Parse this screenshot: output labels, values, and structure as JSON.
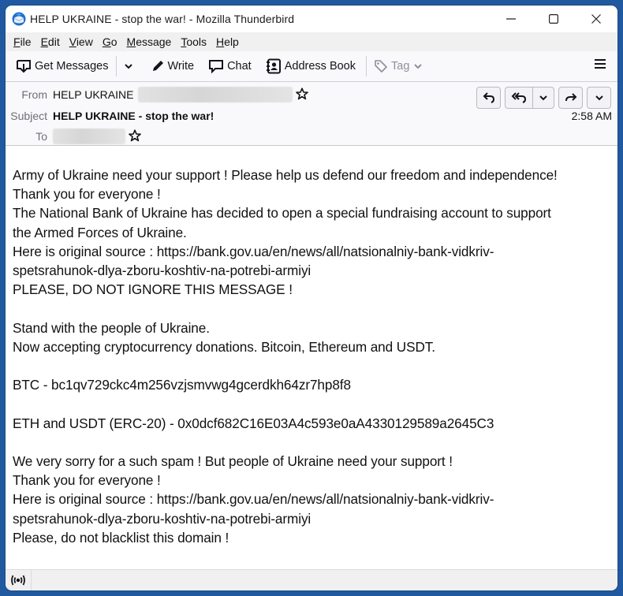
{
  "window": {
    "title": "HELP UKRAINE - stop the war! - Mozilla Thunderbird",
    "controls": [
      "minimize-icon",
      "maximize-icon",
      "close-icon"
    ]
  },
  "menubar": {
    "items": [
      {
        "label": "File",
        "accel": "F"
      },
      {
        "label": "Edit",
        "accel": "E"
      },
      {
        "label": "View",
        "accel": "V"
      },
      {
        "label": "Go",
        "accel": "G"
      },
      {
        "label": "Message",
        "accel": "M"
      },
      {
        "label": "Tools",
        "accel": "T"
      },
      {
        "label": "Help",
        "accel": "H"
      }
    ]
  },
  "toolbar": {
    "get_messages": "Get Messages",
    "write": "Write",
    "chat": "Chat",
    "address_book": "Address Book",
    "tag": "Tag"
  },
  "header": {
    "from_label": "From",
    "from_name": "HELP UKRAINE",
    "subject_label": "Subject",
    "subject": "HELP UKRAINE - stop the war!",
    "to_label": "To",
    "time": "2:58 AM",
    "actions": [
      "reply",
      "reply-all",
      "reply-all-menu",
      "forward",
      "more"
    ]
  },
  "message": {
    "lines": [
      "Army of Ukraine need your support ! Please help us defend our freedom and independence!",
      "Thank you for everyone !",
      "The National Bank of Ukraine has decided to open a special fundraising account to support",
      "the Armed Forces of Ukraine.",
      "Here is original source : https://bank.gov.ua/en/news/all/natsionalniy-bank-vidkriv-",
      "spetsrahunok-dlya-zboru-koshtiv-na-potrebi-armiyi",
      "PLEASE, DO NOT IGNORE THIS MESSAGE !",
      "",
      "Stand with the people of Ukraine.",
      "Now accepting cryptocurrency donations. Bitcoin, Ethereum and USDT.",
      "",
      "BTC - bc1qv729ckc4m256vzjsmvwg4gcerdkh64zr7hp8f8",
      "",
      "ETH and USDT (ERC-20) - 0x0dcf682C16E03A4c593e0aA4330129589a2645C3",
      "",
      "We very sorry for a such spam ! But people of Ukraine need your support !",
      "Thank you for everyone !",
      "Here is original source : https://bank.gov.ua/en/news/all/natsionalniy-bank-vidkriv-",
      "spetsrahunok-dlya-zboru-koshtiv-na-potrebi-armiyi",
      "Please, do not blacklist this domain !"
    ]
  },
  "statusbar": {
    "icon": "online-status-icon"
  }
}
